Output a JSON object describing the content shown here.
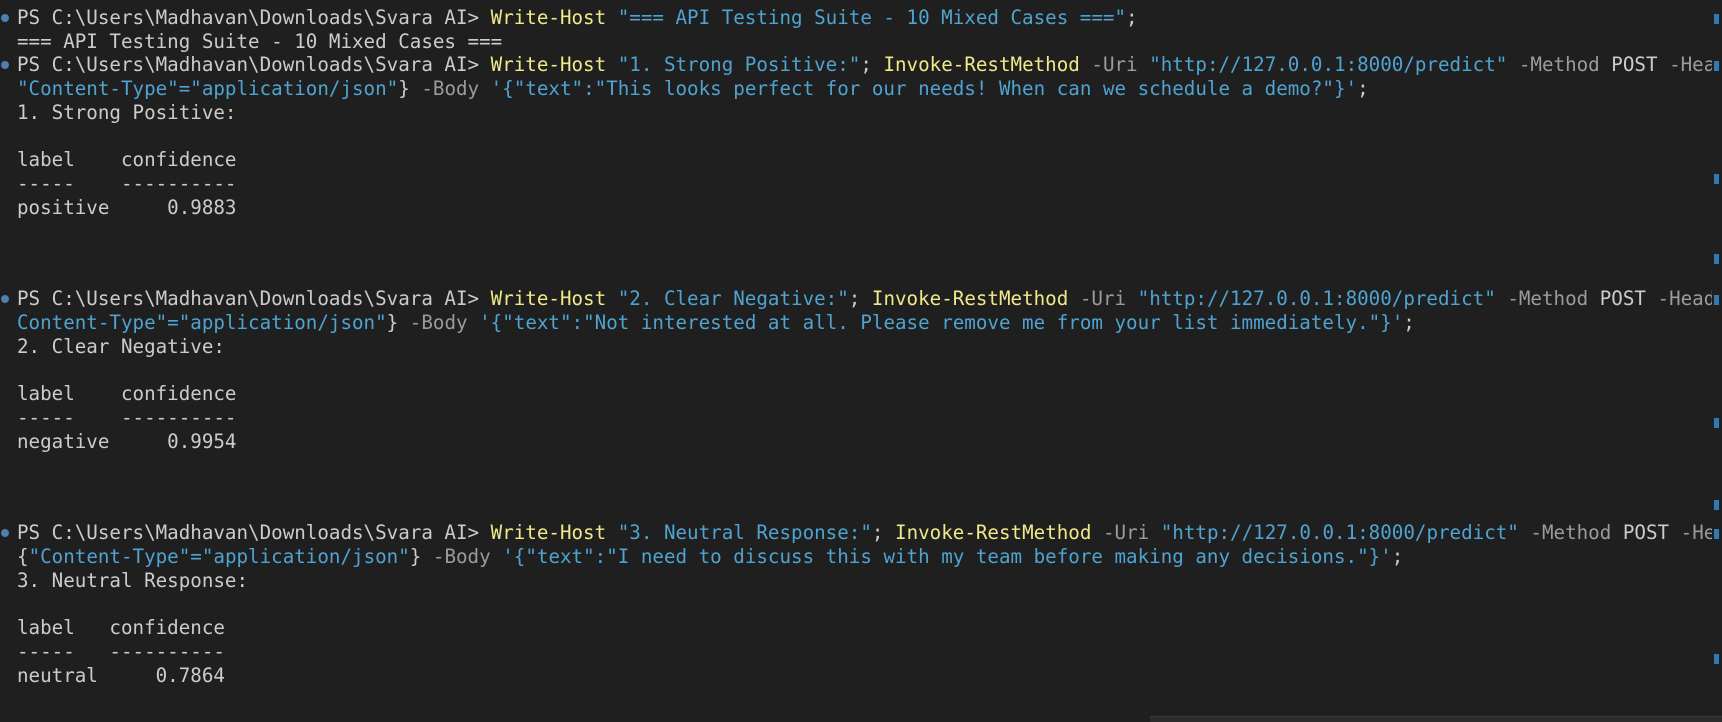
{
  "colors": {
    "background": "#1f1f1f",
    "prompt_text": "#cccccc",
    "cmdlet": "#f0e98a",
    "string": "#4fa3d1",
    "parameter": "#9b9b9b",
    "decoration_dot": "#4d7fb0",
    "scroll_marker": "#2f79b5"
  },
  "terminal": {
    "prompt": "PS C:\\Users\\Madhavan\\Downloads\\Svara AI>",
    "cmd0": {
      "cmdlet": "Write-Host",
      "string": "\"=== API Testing Suite - 10 Mixed Cases ===\"",
      "end": ";"
    },
    "out0": "=== API Testing Suite - 10 Mixed Cases ===",
    "cmd1": {
      "wh": "Write-Host",
      "wh_str": "\"1. Strong Positive:\"",
      "sep": ";",
      "irm": "Invoke-RestMethod",
      "p_uri": "-Uri",
      "uri": "\"http://127.0.0.1:8000/predict\"",
      "p_method": "-Method",
      "method": "POST",
      "p_headers": "-Headers",
      "at": "@{",
      "wrap_hdr": "\"Content-Type\"=\"application/json\"",
      "wrap_close": "}",
      "p_body": "-Body",
      "body": "'{\"text\":\"This looks perfect for our needs! When can we schedule a demo?\"}'",
      "end": ";"
    },
    "out1": "1. Strong Positive:",
    "cmd2": {
      "wh": "Write-Host",
      "wh_str": "\"2. Clear Negative:\"",
      "sep": ";",
      "irm": "Invoke-RestMethod",
      "p_uri": "-Uri",
      "uri": "\"http://127.0.0.1:8000/predict\"",
      "p_method": "-Method",
      "method": "POST",
      "p_headers": "-Headers",
      "at": "@{\"",
      "wrap_hdr": "Content-Type\"=\"application/json\"",
      "wrap_close": "}",
      "p_body": "-Body",
      "body": "'{\"text\":\"Not interested at all. Please remove me from your list immediately.\"}'",
      "end": ";"
    },
    "out2": "2. Clear Negative:",
    "cmd3": {
      "wh": "Write-Host",
      "wh_str": "\"3. Neutral Response:\"",
      "sep": ";",
      "irm": "Invoke-RestMethod",
      "p_uri": "-Uri",
      "uri": "\"http://127.0.0.1:8000/predict\"",
      "p_method": "-Method",
      "method": "POST",
      "p_headers": "-Headers",
      "at": "@",
      "wrap_open": "{",
      "wrap_hdr": "\"Content-Type\"=\"application/json\"",
      "wrap_close": "}",
      "p_body": "-Body",
      "body": "'{\"text\":\"I need to discuss this with my team before making any decisions.\"}'",
      "end": ";"
    },
    "out3": "3. Neutral Response:",
    "table1": {
      "header": "label    confidence",
      "divider": "-----    ----------",
      "row": "positive     0.9883"
    },
    "table2": {
      "header": "label    confidence",
      "divider": "-----    ----------",
      "row": "negative     0.9954"
    },
    "table3": {
      "header": "label   confidence",
      "divider": "-----   ----------",
      "row": "neutral     0.7864"
    }
  }
}
